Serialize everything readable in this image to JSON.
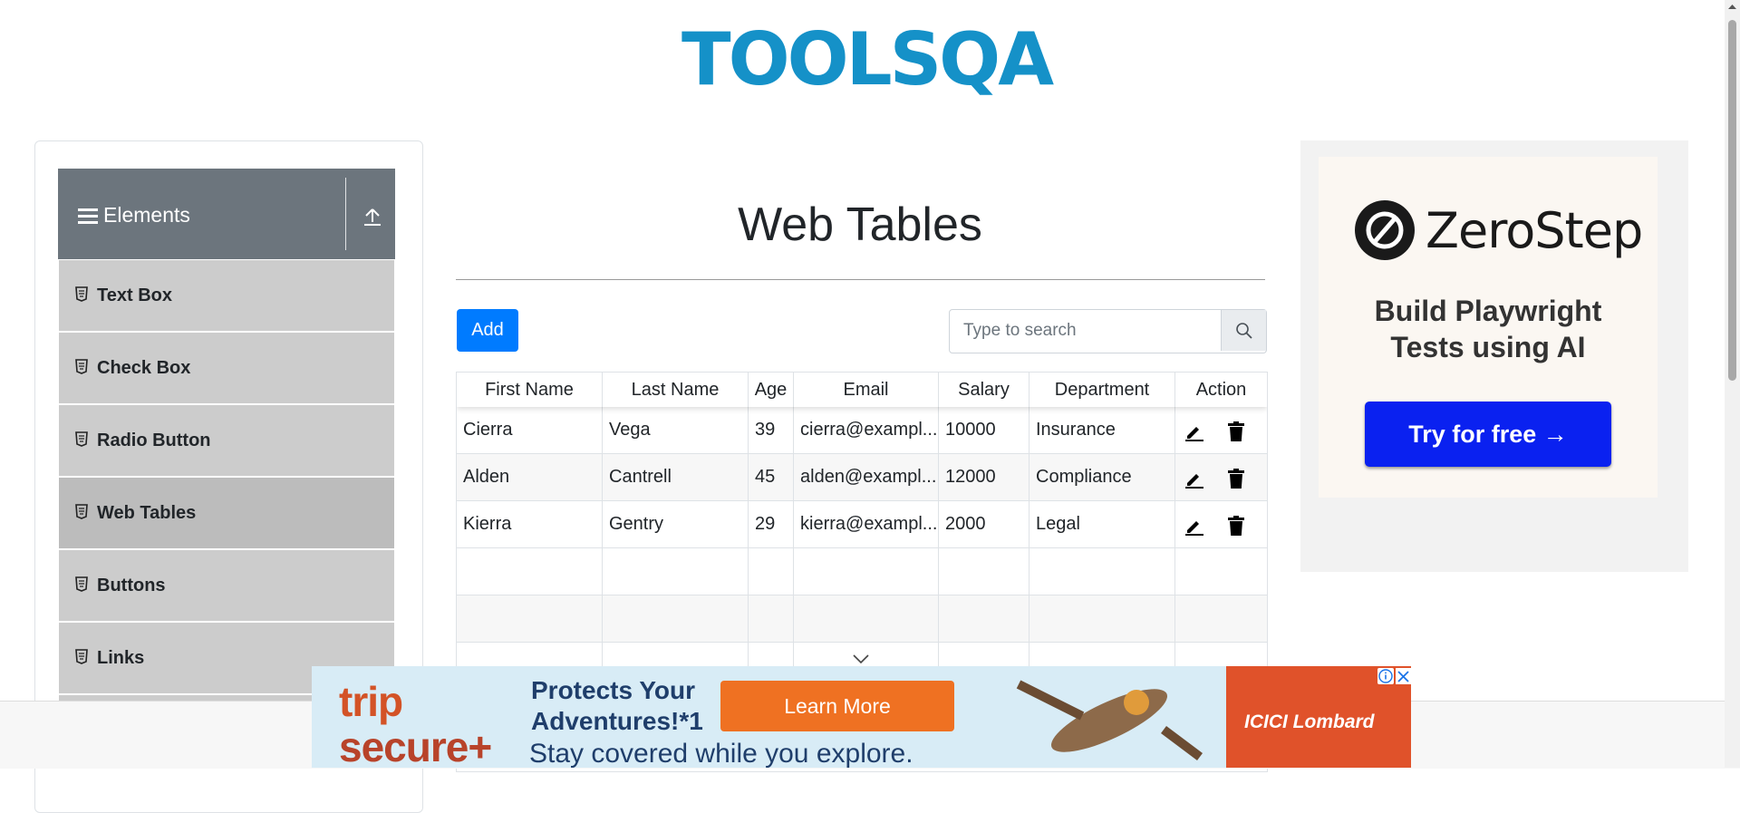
{
  "header": {
    "logo_text": "TOOLSQA"
  },
  "sidebar": {
    "group_title": "Elements",
    "items": [
      {
        "label": "Text Box"
      },
      {
        "label": "Check Box"
      },
      {
        "label": "Radio Button"
      },
      {
        "label": "Web Tables",
        "active": true
      },
      {
        "label": "Buttons"
      },
      {
        "label": "Links"
      }
    ]
  },
  "main": {
    "title": "Web Tables",
    "add_label": "Add",
    "search": {
      "placeholder": "Type to search",
      "value": ""
    },
    "table": {
      "columns": [
        "First Name",
        "Last Name",
        "Age",
        "Email",
        "Salary",
        "Department",
        "Action"
      ],
      "rows": [
        [
          "Cierra",
          "Vega",
          "39",
          "cierra@exampl...",
          "10000",
          "Insurance"
        ],
        [
          "Alden",
          "Cantrell",
          "45",
          "alden@exampl...",
          "12000",
          "Compliance"
        ],
        [
          "Kierra",
          "Gentry",
          "29",
          "kierra@exampl...",
          "2000",
          "Legal"
        ]
      ]
    }
  },
  "ad_right": {
    "brand": "ZeroStep",
    "tagline_line1": "Build Playwright",
    "tagline_line2": "Tests using AI",
    "cta": "Try for free →"
  },
  "ad_bottom": {
    "brand_line1": "trip",
    "brand_line2": "secure+",
    "headline_line1": "Protects Your",
    "headline_line2": "Adventures!*1",
    "subline": "Stay covered while you explore.",
    "cta": "Learn More",
    "sponsor": "ICICI Lombard"
  },
  "colors": {
    "primary": "#007bff",
    "sidebar_header": "#6c757d",
    "menu_item": "#cccccc",
    "logo_blue": "#1591c8",
    "zs_cta": "#0a21f0"
  }
}
